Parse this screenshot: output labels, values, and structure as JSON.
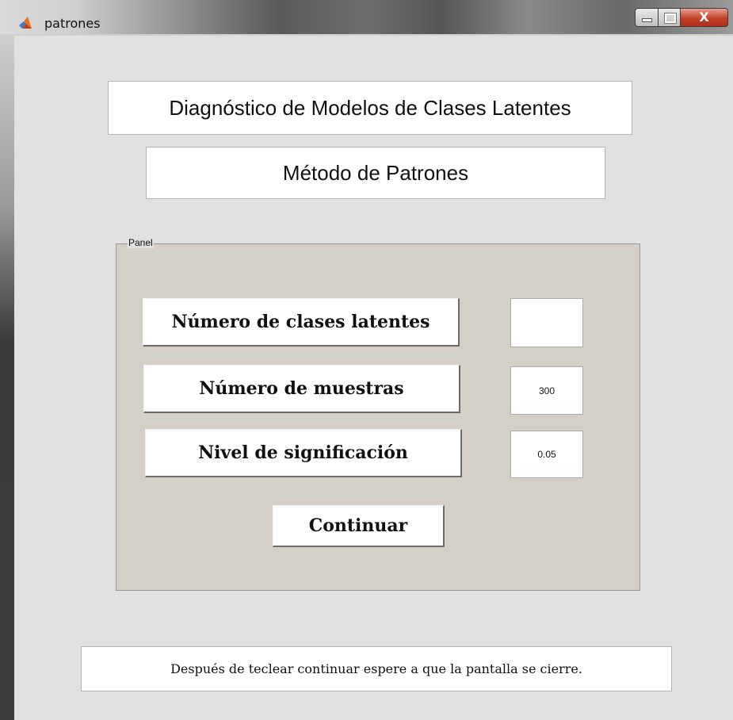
{
  "window": {
    "title": "patrones",
    "close_glyph": "X",
    "icon": "matlab-logo-icon"
  },
  "headings": {
    "title": "Diagnóstico de Modelos de Clases Latentes",
    "subtitle": "Método de Patrones"
  },
  "panel": {
    "label": "Panel",
    "buttons": {
      "clases": "Número de clases latentes",
      "muestras": "Número de muestras",
      "nivel": "Nivel de significación",
      "continuar": "Continuar"
    },
    "fields": {
      "clases": "",
      "muestras": "300",
      "nivel": "0.05"
    }
  },
  "note": "Después de teclear continuar espere a que la pantalla se cierre.",
  "colors": {
    "client_bg": "#e1e1e1",
    "panel_bg": "#d4d0c8",
    "close_button": "#c0412a"
  }
}
